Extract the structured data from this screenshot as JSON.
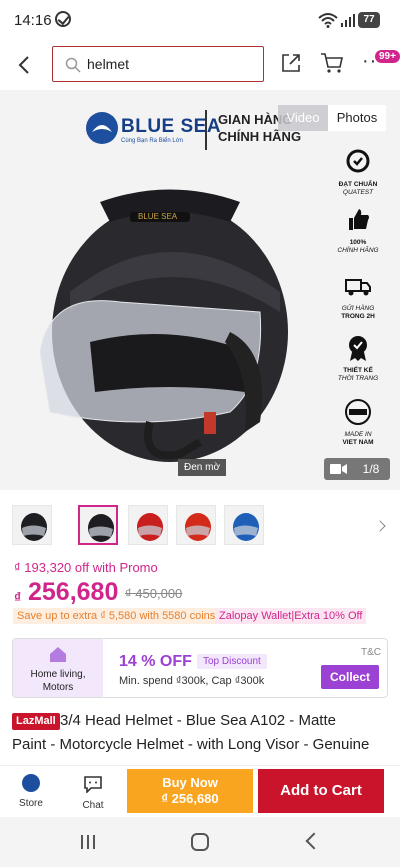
{
  "status_bar": {
    "time": "14:16",
    "battery": "77"
  },
  "search": {
    "value": "helmet"
  },
  "header": {
    "cart_badge": "99+"
  },
  "hero": {
    "brand_name": "BLUE SEA",
    "brand_tagline": "Cùng Bạn Ra Biển Lớn",
    "brand_label_1": "GIAN HÀNG",
    "brand_label_2": "CHÍNH HÃNG",
    "media_toggle": {
      "video": "Video",
      "photos": "Photos"
    },
    "features": [
      {
        "line1": "ĐẠT CHUẨN",
        "line2": "QUATEST",
        "icon": "quality-check-icon"
      },
      {
        "line1": "100%",
        "line2": "CHÍNH HÃNG",
        "icon": "thumbs-up-stars-icon"
      },
      {
        "line1": "GỬI HÀNG",
        "line2": "TRONG 2H",
        "icon": "delivery-truck-icon"
      },
      {
        "line1": "THIẾT KẾ",
        "line2": "THỜI TRANG",
        "icon": "award-badge-icon"
      },
      {
        "line1": "MADE IN",
        "line2": "VIET NAM",
        "icon": "vietnam-stamp-icon"
      }
    ],
    "color_label": "Đen mờ",
    "image_counter": "1/8"
  },
  "thumbnails": [
    {
      "color": "#1e1e22",
      "selected": false
    },
    {
      "color": "#1e1e22",
      "selected": true
    },
    {
      "color": "#c81e1e",
      "selected": false
    },
    {
      "color": "#d42a1a",
      "selected": false
    },
    {
      "color": "#1f5fb8",
      "selected": false
    }
  ],
  "price": {
    "promo_off": "₫ 193,320 off with Promo",
    "currency": "₫",
    "current": "256,680",
    "original": "₫ 450,000",
    "coins_offer": "Save up to extra ₫ 5,580 with 5580 coins",
    "zalopay_offer": "Zalopay Wallet|Extra 10% Off"
  },
  "voucher": {
    "category_line1": "Home living,",
    "category_line2": "Motors",
    "percent": "14 % OFF",
    "tag": "Top Discount",
    "terms": "Min. spend ₫300k, Cap ₫300k",
    "tc_label": "T&C",
    "collect_label": "Collect"
  },
  "product": {
    "mall_badge": "LazMall",
    "title_line1": "3/4 Head Helmet - Blue Sea A102 - Matte",
    "title_line2": "Paint - Motorcycle Helmet - with Long Visor - Genuine"
  },
  "bottom_bar": {
    "store_label": "Store",
    "chat_label": "Chat",
    "buy_now_label": "Buy Now",
    "buy_now_price": "₫ 256,680",
    "add_to_cart_label": "Add to Cart"
  },
  "colors": {
    "accent": "#d0268c",
    "brand_red": "#c9142b",
    "buy_orange": "#f9a520",
    "voucher_purple": "#9b41d4"
  }
}
